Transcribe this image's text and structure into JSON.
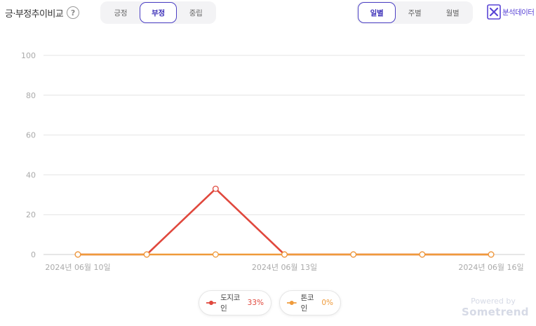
{
  "header": {
    "title": "긍·부정추이비교",
    "help_icon": "question-mark-icon"
  },
  "sentiment_tabs": {
    "items": [
      "긍정",
      "부정",
      "중립"
    ],
    "active": "부정"
  },
  "period_tabs": {
    "items": [
      "일별",
      "주별",
      "월별"
    ],
    "active": "일별"
  },
  "excel_button": {
    "label": "분석데이터",
    "icon": "excel-icon"
  },
  "colors": {
    "accent": "#4b3fc4",
    "series_doge": "#e0483d",
    "series_ton": "#ef9a3a",
    "grid": "#e4e4e4",
    "axis_text": "#aaaaaa"
  },
  "chart_data": {
    "type": "line",
    "x": [
      "2024-06-10",
      "2024-06-11",
      "2024-06-12",
      "2024-06-13",
      "2024-06-14",
      "2024-06-15",
      "2024-06-16"
    ],
    "x_tick_labels": [
      "2024년 06월 10일",
      "2024년 06월 13일",
      "2024년 06월 16일"
    ],
    "x_tick_dates": [
      "2024-06-10",
      "2024-06-13",
      "2024-06-16"
    ],
    "y_ticks": [
      0,
      20,
      40,
      60,
      80,
      100
    ],
    "ylim": [
      0,
      100
    ],
    "grid": true,
    "legend_position": "bottom-center",
    "series": [
      {
        "name": "도지코인",
        "percent": "33%",
        "values": [
          0,
          0,
          33,
          0,
          0,
          0,
          0
        ]
      },
      {
        "name": "톤코인",
        "percent": "0%",
        "values": [
          0,
          0,
          0,
          0,
          0,
          0,
          0
        ]
      }
    ]
  },
  "footer": {
    "powered_by": "Powered by",
    "brand": "Sometrend"
  }
}
